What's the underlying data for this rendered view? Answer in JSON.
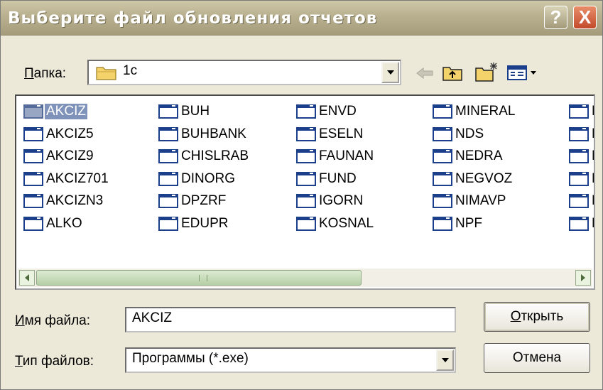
{
  "window": {
    "title": "Выберите файл обновления отчетов"
  },
  "titlebar_buttons": {
    "help": "?",
    "close": "X"
  },
  "folder": {
    "label": "Папка:",
    "value": "1с"
  },
  "files": {
    "columns": [
      [
        "AKCIZ",
        "AKCIZ5",
        "AKCIZ9",
        "AKCIZ701",
        "AKCIZN3",
        "ALKO"
      ],
      [
        "BUH",
        "BUHBANK",
        "CHISLRAB",
        "DINORG",
        "DPZRF",
        "EDUPR"
      ],
      [
        "ENVD",
        "ESELN",
        "FAUNAN",
        "FUND",
        "IGORN",
        "KOSNAL"
      ],
      [
        "MINERAL",
        "NDS",
        "NEDRA",
        "NEGVOZ",
        "NIMAVP",
        "NPF"
      ],
      [
        "P",
        "P",
        "P",
        "P",
        "P",
        "P"
      ]
    ],
    "selected": "AKCIZ"
  },
  "filename": {
    "label": "Имя файла:",
    "value": "AKCIZ"
  },
  "filetype": {
    "label": "Тип файлов:",
    "value": "Программы (*.exe)"
  },
  "buttons": {
    "open": "Открыть",
    "cancel": "Отмена"
  },
  "colors": {
    "title_gradient_top": "#cfc8a8",
    "selection": "#7e92ba",
    "close_button": "#c24a2a",
    "icon_border": "#1c3f8c"
  },
  "icons": [
    "back-arrow-icon",
    "up-folder-icon",
    "new-folder-icon",
    "view-menu-icon",
    "folder-icon",
    "program-file-icon"
  ]
}
